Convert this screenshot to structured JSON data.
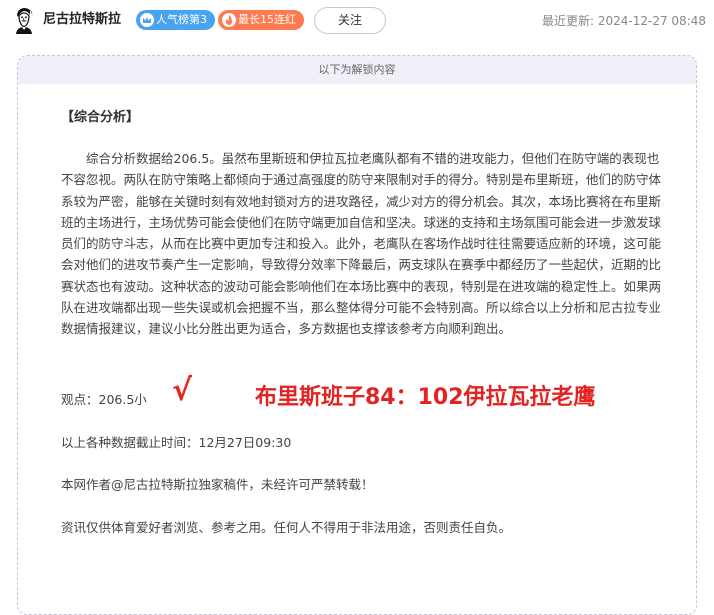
{
  "header": {
    "author_name": "尼古拉特斯拉",
    "badges": [
      {
        "label": "人气榜第3",
        "icon": "crown-icon",
        "color": "#4aa3f0"
      },
      {
        "label": "最长15连红",
        "icon": "flame-icon",
        "color": "#ff7a50"
      }
    ],
    "follow_label": "关注",
    "update_label": "最近更新:",
    "update_time": "2024-12-27 08:48"
  },
  "card": {
    "banner": "以下为解锁内容",
    "section_title": "【综合分析】",
    "paragraph": "综合分析数据给206.5。虽然布里斯班和伊拉瓦拉老鹰队都有不错的进攻能力，但他们在防守端的表现也不容忽视。两队在防守策略上都倾向于通过高强度的防守来限制对手的得分。特别是布里斯班，他们的防守体系较为严密，能够在关键时刻有效地封锁对方的进攻路径，减少对方的得分机会。其次，本场比赛将在布里斯班的主场进行，主场优势可能会使他们在防守端更加自信和坚决。球迷的支持和主场氛围可能会进一步激发球员们的防守斗志，从而在比赛中更加专注和投入。此外，老鹰队在客场作战时往往需要适应新的环境，这可能会对他们的进攻节奏产生一定影响，导致得分效率下降最后，两支球队在赛季中都经历了一些起伏，近期的比赛状态也有波动。这种状态的波动可能会影响他们在本场比赛中的表现，特别是在进攻端的稳定性上。如果两队在进攻端都出现一些失误或机会把握不当，那么整体得分可能不会特别高。所以综合以上分析和尼古拉专业数据情报建议，建议小比分胜出更为适合，多方数据也支撑该参考方向顺利跑出。",
    "viewpoint": "观点：206.5小",
    "check": "√",
    "result": "布里斯班子84：102伊拉瓦拉老鹰",
    "cutoff": "以上各种数据截止时间：12月27日09:30",
    "copyright": "本网作者@尼古拉特斯拉独家稿件，未经许可严禁转载！",
    "disclaimer": "资讯仅供体育爱好者浏览、参考之用。任何人不得用于非法用途，否则责任自负。"
  },
  "colors": {
    "accent_red": "#e32222",
    "banner_bg": "#f1f0f8",
    "card_border": "#c5c0e0"
  },
  "icons": {
    "avatar": "tesla-portrait-avatar"
  }
}
